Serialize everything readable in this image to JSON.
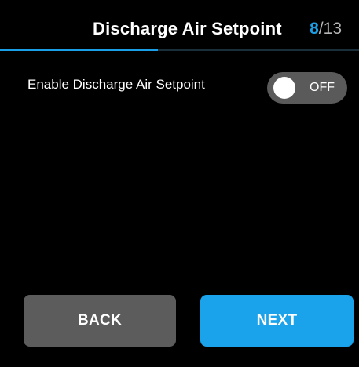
{
  "header": {
    "title": "Discharge Air Setpoint",
    "step_current": "8",
    "step_separator": "/",
    "step_total": "13",
    "progress_fraction": 0.44
  },
  "setting": {
    "label": "Enable Discharge Air Setpoint",
    "toggle_state": "OFF"
  },
  "buttons": {
    "back_label": "BACK",
    "next_label": "NEXT"
  },
  "colors": {
    "accent": "#1a9fe6",
    "background": "#000000",
    "button_secondary": "#5c5c5c",
    "toggle_off": "#5a5a5a"
  }
}
